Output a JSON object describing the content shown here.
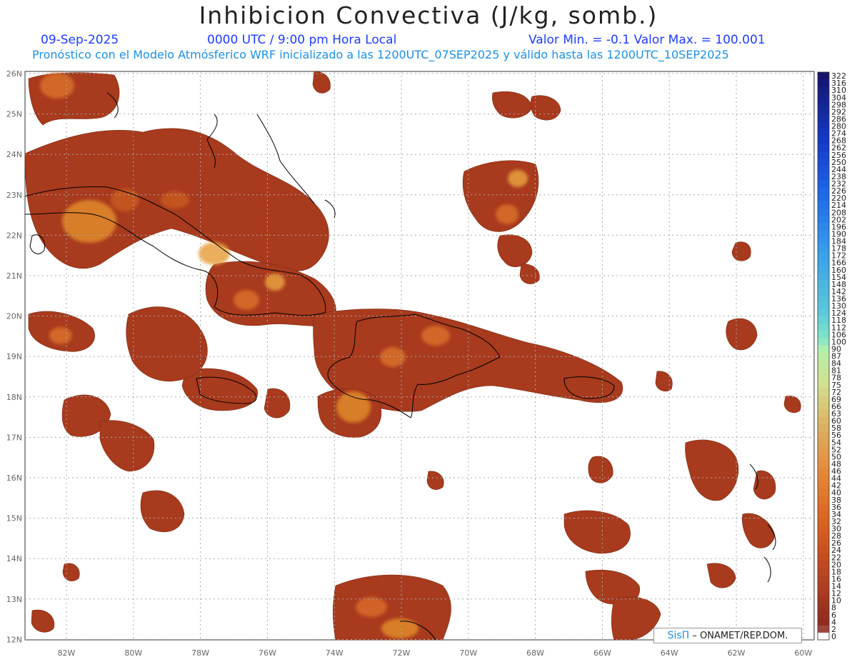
{
  "title": "Inhibicion Convectiva (J/kg, somb.)",
  "header": {
    "date": "09-Sep-2025",
    "time": "0000 UTC / 9:00 pm Hora Local",
    "range": "Valor Min. = -0.1  Valor Max. = 100.001",
    "model": "Pronóstico con el Modelo Atmósferico WRF inicializado a las 1200UTC_07SEP2025 y válido hasta las  1200UTC_10SEP2025"
  },
  "map": {
    "lat_labels": [
      "26N",
      "25N",
      "24N",
      "23N",
      "22N",
      "21N",
      "20N",
      "19N",
      "18N",
      "17N",
      "16N",
      "15N",
      "14N",
      "13N",
      "12N"
    ],
    "lon_labels": [
      "82W",
      "80W",
      "78W",
      "76W",
      "74W",
      "72W",
      "70W",
      "68W",
      "66W",
      "64W",
      "62W",
      "60W"
    ],
    "field_color": "#a83a1e",
    "coast_color": "#000000"
  },
  "colorbar": {
    "labels": [
      "322",
      "316",
      "310",
      "304",
      "298",
      "292",
      "286",
      "280",
      "274",
      "268",
      "262",
      "256",
      "250",
      "244",
      "238",
      "232",
      "226",
      "220",
      "214",
      "208",
      "202",
      "196",
      "190",
      "184",
      "178",
      "172",
      "166",
      "160",
      "154",
      "148",
      "142",
      "136",
      "130",
      "124",
      "118",
      "112",
      "106",
      "100",
      "90",
      "87",
      "84",
      "81",
      "78",
      "75",
      "72",
      "69",
      "66",
      "63",
      "60",
      "58",
      "56",
      "54",
      "52",
      "50",
      "48",
      "46",
      "44",
      "42",
      "40",
      "38",
      "36",
      "34",
      "32",
      "30",
      "28",
      "26",
      "24",
      "22",
      "20",
      "18",
      "16",
      "14",
      "12",
      "10",
      "8",
      "6",
      "4",
      "2",
      "0"
    ]
  },
  "credit": {
    "brand": "SisΠ",
    "text": " – ONAMET/REP.DOM."
  }
}
